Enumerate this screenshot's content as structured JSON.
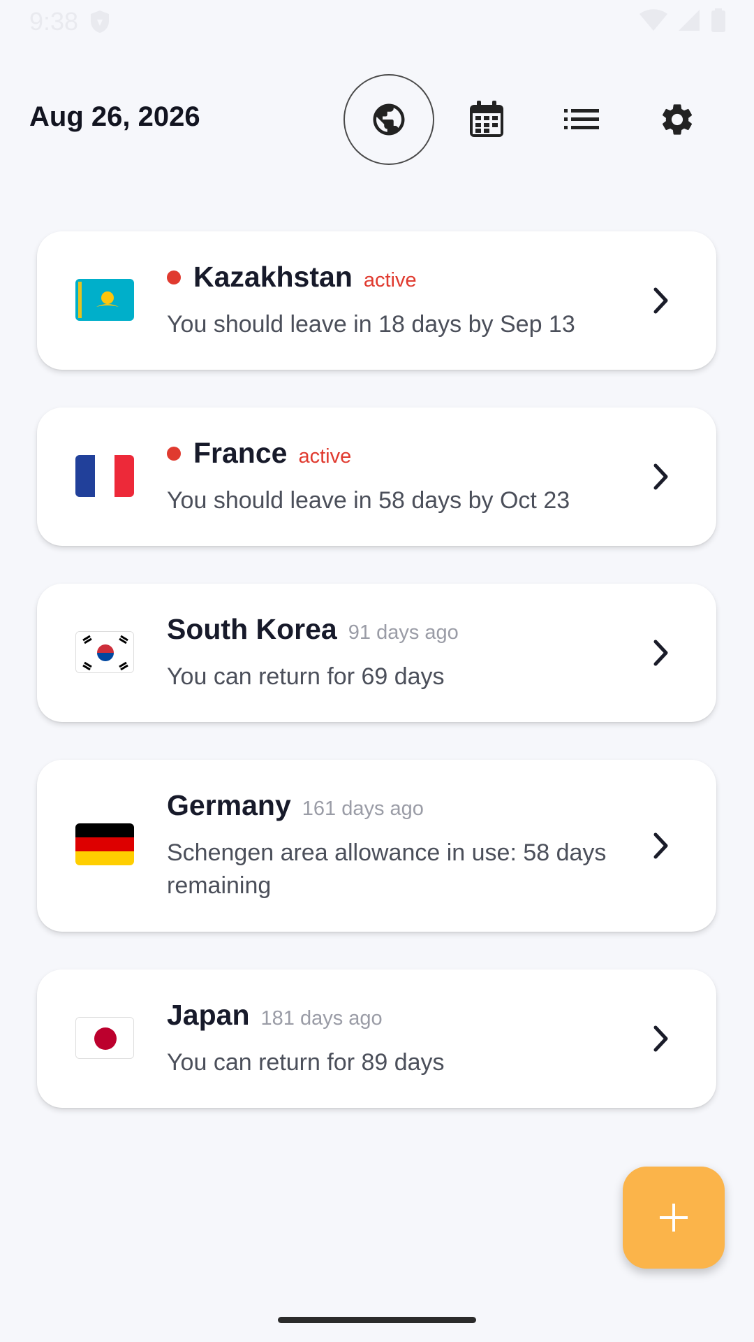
{
  "status": {
    "time": "9:38"
  },
  "header": {
    "date": "Aug 26, 2026"
  },
  "nav": [
    {
      "icon": "globe-icon",
      "selected": true
    },
    {
      "icon": "calendar-icon",
      "selected": false
    },
    {
      "icon": "list-icon",
      "selected": false
    },
    {
      "icon": "gear-icon",
      "selected": false
    }
  ],
  "trips": [
    {
      "country": "Kazakhstan",
      "tag": "active",
      "active": true,
      "description": "You should leave in 18 days by Sep 13",
      "flag": "kazakhstan-flag"
    },
    {
      "country": "France",
      "tag": "active",
      "active": true,
      "description": "You should leave in 58 days by Oct 23",
      "flag": "france-flag"
    },
    {
      "country": "South Korea",
      "tag": "91 days ago",
      "active": false,
      "description": "You can return for 69 days",
      "flag": "south-korea-flag"
    },
    {
      "country": "Germany",
      "tag": "161 days ago",
      "active": false,
      "description": "Schengen area allowance in use: 58 days remaining",
      "flag": "germany-flag"
    },
    {
      "country": "Japan",
      "tag": "181 days ago",
      "active": false,
      "description": "You can return for 89 days",
      "flag": "japan-flag"
    }
  ],
  "colors": {
    "active": "#e03a2f",
    "fab": "#fbb44a",
    "background": "#f6f7fb"
  },
  "fab": {
    "icon": "plus-icon"
  }
}
